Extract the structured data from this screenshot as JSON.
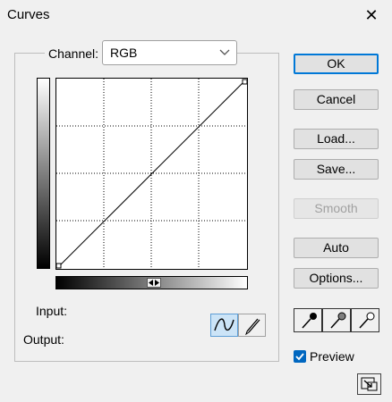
{
  "window": {
    "title": "Curves",
    "close_symbol": "✕"
  },
  "channel": {
    "label": "Channel:",
    "value": "RGB"
  },
  "labels": {
    "input": "Input:",
    "output": "Output:"
  },
  "buttons": {
    "ok": "OK",
    "cancel": "Cancel",
    "load": "Load...",
    "save": "Save...",
    "smooth": "Smooth",
    "auto": "Auto",
    "options": "Options..."
  },
  "preview": {
    "label": "Preview",
    "checked": true
  },
  "colors": {
    "accent": "#0078d7",
    "checkbox": "#0067c0",
    "selected_tool": "#cce4f7"
  }
}
